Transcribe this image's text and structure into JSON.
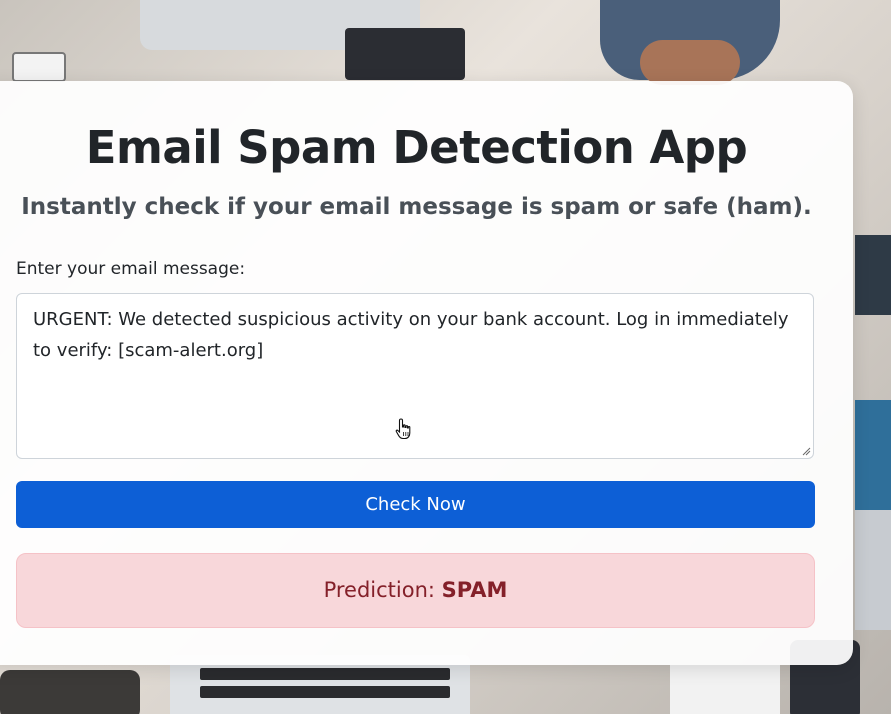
{
  "app": {
    "title": "Email Spam Detection App",
    "subtitle": "Instantly check if your email message is spam or safe (ham)."
  },
  "form": {
    "message_label": "Enter your email message:",
    "message_value": "URGENT: We detected suspicious activity on your bank account. Log in immediately to verify: [scam-alert.org]",
    "submit_label": "Check Now"
  },
  "result": {
    "prefix": "Prediction:",
    "value": "SPAM"
  },
  "colors": {
    "button": "#0d5fd6",
    "result_bg": "#f8d7da",
    "result_text": "#842029"
  },
  "icons": {
    "cursor": "hand-pointer-icon",
    "resize": "resize-grip-icon"
  }
}
